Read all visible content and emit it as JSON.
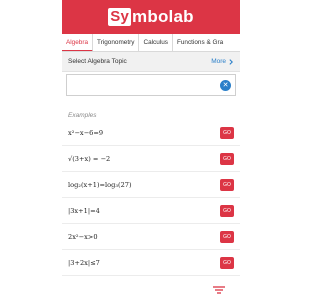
{
  "app": {
    "logo_box": "Sy",
    "logo_rest": "mbolab"
  },
  "tabs": [
    {
      "label": "Algebra",
      "active": true
    },
    {
      "label": "Trigonometry",
      "active": false
    },
    {
      "label": "Calculus",
      "active": false
    },
    {
      "label": "Functions & Gra",
      "active": false
    }
  ],
  "topic": {
    "title": "Select Algebra Topic",
    "more_label": "More"
  },
  "search": {
    "value": "",
    "clear_icon": "close-icon"
  },
  "examples": {
    "label": "Examples",
    "go_label": "GO",
    "items": [
      {
        "expr": "x²−x−6=9"
      },
      {
        "expr": "√(3+x) = −2"
      },
      {
        "expr": "log₂(x+1)=log₃(27)"
      },
      {
        "expr": "|3x+1|=4"
      },
      {
        "expr": "2x²−x>0"
      },
      {
        "expr": "|3+2x|≤7"
      }
    ]
  },
  "colors": {
    "accent": "#dc3545",
    "link": "#2a7fc9"
  }
}
